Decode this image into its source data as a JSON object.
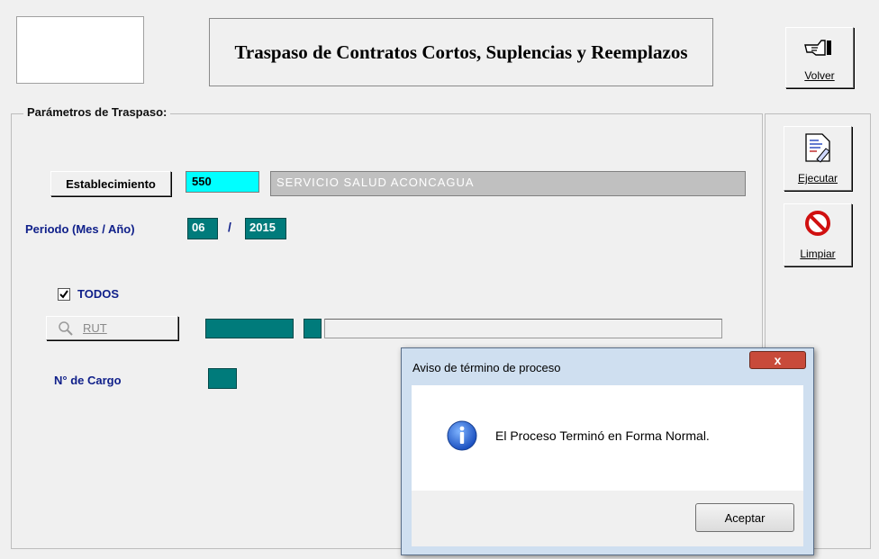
{
  "header": {
    "title": "Traspaso de Contratos Cortos, Suplencias y Reemplazos"
  },
  "side": {
    "volver": "Volver",
    "ejecutar": "Ejecutar",
    "limpiar": "Limpiar"
  },
  "form": {
    "group_label": "Parámetros de Traspaso:",
    "establecimiento_button": "Establecimiento",
    "establecimiento_code": "550",
    "establecimiento_name": "SERVICIO SALUD ACONCAGUA",
    "periodo_label": "Periodo (Mes / Año)",
    "month": "06",
    "separator": "/",
    "year": "2015",
    "todos_label": "TODOS",
    "todos_checked": true,
    "rut_button": "RUT",
    "cargo_label": "N° de Cargo"
  },
  "dialog": {
    "title": "Aviso de término de proceso",
    "close": "x",
    "message": "El Proceso Terminó en Forma Normal.",
    "ok": "Aceptar"
  },
  "icons": [
    "pointing-hand-icon",
    "document-pen-icon",
    "no-sign-icon",
    "info-icon",
    "checkbox-icon",
    "search-icon"
  ]
}
